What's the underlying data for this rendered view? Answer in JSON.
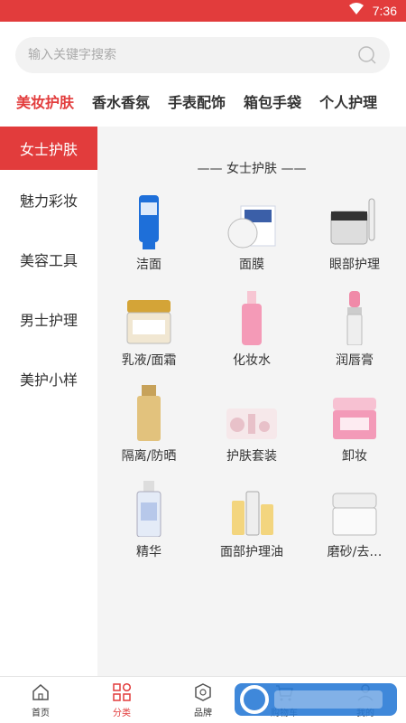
{
  "status_bar": {
    "time": "7:36"
  },
  "search": {
    "placeholder": "输入关键字搜索"
  },
  "top_tabs": [
    {
      "label": "美妆护肤",
      "active": true
    },
    {
      "label": "香水香氛",
      "active": false
    },
    {
      "label": "手表配饰",
      "active": false
    },
    {
      "label": "箱包手袋",
      "active": false
    },
    {
      "label": "个人护理",
      "active": false
    }
  ],
  "sidebar": {
    "items": [
      {
        "label": "女士护肤",
        "active": true
      },
      {
        "label": "魅力彩妆",
        "active": false
      },
      {
        "label": "美容工具",
        "active": false
      },
      {
        "label": "男士护理",
        "active": false
      },
      {
        "label": "美护小样",
        "active": false
      }
    ]
  },
  "content": {
    "section_title": "—— 女士护肤 ——",
    "products": [
      {
        "label": "洁面",
        "icon": "cleanser-tube-icon"
      },
      {
        "label": "面膜",
        "icon": "face-mask-icon"
      },
      {
        "label": "眼部护理",
        "icon": "eye-cream-jar-icon"
      },
      {
        "label": "乳液/面霜",
        "icon": "cream-jar-icon"
      },
      {
        "label": "化妆水",
        "icon": "toner-bottle-icon"
      },
      {
        "label": "润唇膏",
        "icon": "lip-balm-icon"
      },
      {
        "label": "隔离/防晒",
        "icon": "sunscreen-bottle-icon"
      },
      {
        "label": "护肤套装",
        "icon": "skincare-set-icon"
      },
      {
        "label": "卸妆",
        "icon": "makeup-remover-jar-icon"
      },
      {
        "label": "精华",
        "icon": "essence-bottle-icon"
      },
      {
        "label": "面部护理油",
        "icon": "facial-oil-icon"
      },
      {
        "label": "磨砂/去…",
        "icon": "scrub-jar-icon"
      }
    ]
  },
  "bottom_nav": [
    {
      "label": "首页",
      "icon": "home-icon",
      "active": false
    },
    {
      "label": "分类",
      "icon": "category-icon",
      "active": true
    },
    {
      "label": "品牌",
      "icon": "brand-icon",
      "active": false
    },
    {
      "label": "购物车",
      "icon": "cart-icon",
      "active": false
    },
    {
      "label": "我的",
      "icon": "profile-icon",
      "active": false
    }
  ],
  "colors": {
    "accent": "#e23c3c",
    "content_bg": "#f4f4f4"
  }
}
